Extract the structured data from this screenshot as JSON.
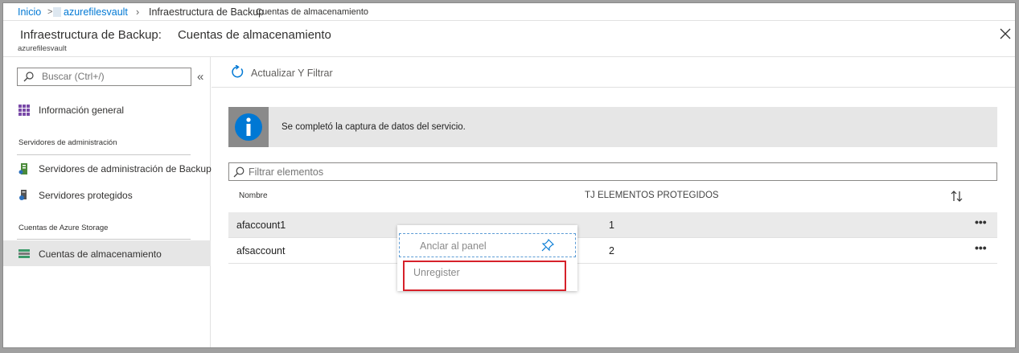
{
  "breadcrumb": {
    "home": "Inicio",
    "sep": ">",
    "vault": "azurefilesvault",
    "chev": "›",
    "infra": "Infraestructura de Backup",
    "cuentas": "Cuentas de almacenamiento"
  },
  "blade": {
    "title": "Infraestructura de Backup:",
    "title_sub": "Cuentas de almacenamiento",
    "subtitle": "azurefilesvault",
    "close_icon": "close-icon"
  },
  "leftmenu": {
    "search_placeholder": "Buscar (Ctrl+/)",
    "collapse": "«",
    "overview": "Información general",
    "section_mgmt": "Servidores de administración",
    "backup_mgmt_servers": "Servidores de administración de Backup",
    "protected_servers": "Servidores protegidos",
    "section_storage": "Cuentas de Azure Storage",
    "storage_accounts": "Cuentas de almacenamiento"
  },
  "toolbar": {
    "refresh_label": "Actualizar Y Filtrar"
  },
  "info": {
    "message": "Se completó la captura de datos del servicio."
  },
  "filter": {
    "placeholder": "Filtrar elementos"
  },
  "table": {
    "headers": [
      "Nombre",
      "TJ ELEMENTOS PROTEGIDOS"
    ],
    "rows": [
      {
        "name": "afaccount1",
        "count": "1"
      },
      {
        "name": "afsaccount",
        "count": "2"
      }
    ],
    "more": "•••"
  },
  "context_menu": {
    "pin": "Anclar al panel",
    "unregister": "Unregister"
  },
  "colors": {
    "accent": "#0078d4",
    "info_icon_bg": "#8a8a8a",
    "highlight_border": "#d6212a"
  }
}
